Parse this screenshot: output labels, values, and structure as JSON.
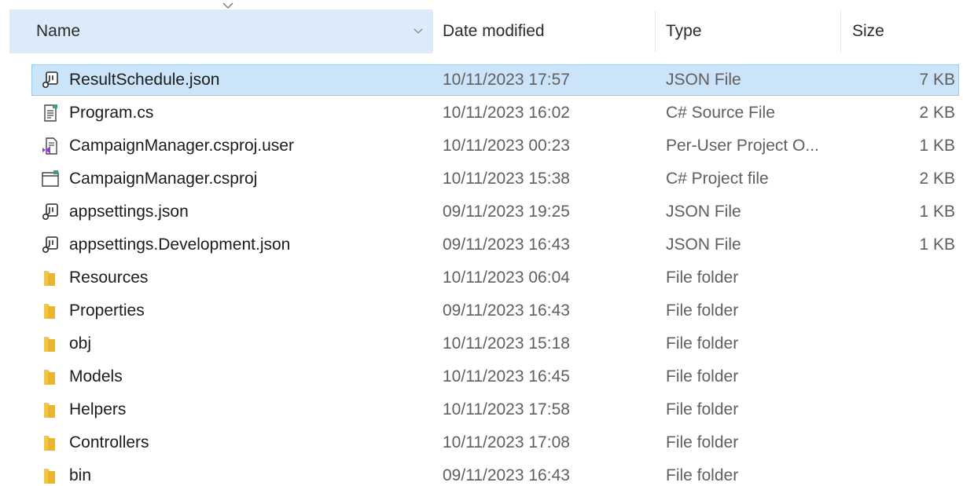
{
  "columns": {
    "name": "Name",
    "date": "Date modified",
    "type": "Type",
    "size": "Size"
  },
  "sort": {
    "column": "name",
    "icon": "sort-caret-icon"
  },
  "colors": {
    "header_selected": "#dcebfa",
    "row_selected": "#cce4f9",
    "row_selected_border": "#99c9ef",
    "folder": "#f4c542"
  },
  "files": [
    {
      "name": "ResultSchedule.json",
      "date": "10/11/2023 17:57",
      "type": "JSON File",
      "size": "7 KB",
      "icon": "json-file-icon",
      "selected": true
    },
    {
      "name": "Program.cs",
      "date": "10/11/2023 16:02",
      "type": "C# Source File",
      "size": "2 KB",
      "icon": "csharp-source-icon",
      "selected": false
    },
    {
      "name": "CampaignManager.csproj.user",
      "date": "10/11/2023 00:23",
      "type": "Per-User Project O...",
      "size": "1 KB",
      "icon": "vs-user-project-icon",
      "selected": false
    },
    {
      "name": "CampaignManager.csproj",
      "date": "10/11/2023 15:38",
      "type": "C# Project file",
      "size": "2 KB",
      "icon": "csproj-icon",
      "selected": false
    },
    {
      "name": "appsettings.json",
      "date": "09/11/2023 19:25",
      "type": "JSON File",
      "size": "1 KB",
      "icon": "json-file-icon",
      "selected": false
    },
    {
      "name": "appsettings.Development.json",
      "date": "09/11/2023 16:43",
      "type": "JSON File",
      "size": "1 KB",
      "icon": "json-file-icon",
      "selected": false
    },
    {
      "name": "Resources",
      "date": "10/11/2023 06:04",
      "type": "File folder",
      "size": "",
      "icon": "folder-icon",
      "selected": false
    },
    {
      "name": "Properties",
      "date": "09/11/2023 16:43",
      "type": "File folder",
      "size": "",
      "icon": "folder-icon",
      "selected": false
    },
    {
      "name": "obj",
      "date": "10/11/2023 15:18",
      "type": "File folder",
      "size": "",
      "icon": "folder-icon",
      "selected": false
    },
    {
      "name": "Models",
      "date": "10/11/2023 16:45",
      "type": "File folder",
      "size": "",
      "icon": "folder-icon",
      "selected": false
    },
    {
      "name": "Helpers",
      "date": "10/11/2023 17:58",
      "type": "File folder",
      "size": "",
      "icon": "folder-icon",
      "selected": false
    },
    {
      "name": "Controllers",
      "date": "10/11/2023 17:08",
      "type": "File folder",
      "size": "",
      "icon": "folder-icon",
      "selected": false
    },
    {
      "name": "bin",
      "date": "09/11/2023 16:43",
      "type": "File folder",
      "size": "",
      "icon": "folder-icon",
      "selected": false
    }
  ]
}
